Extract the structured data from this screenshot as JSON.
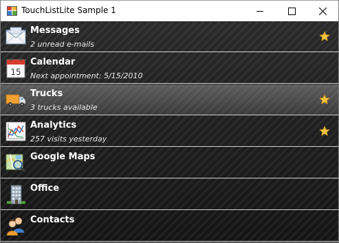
{
  "window": {
    "title": "TouchListLite Sample 1",
    "minimize_icon": "minimize-icon",
    "maximize_icon": "maximize-icon",
    "close_icon": "close-icon"
  },
  "accent_colors": {
    "star": "#f4c23c",
    "separator": "#d4d4d4",
    "selected_row": "#4a4a4a"
  },
  "items": [
    {
      "label": "Messages",
      "subtitle": "2 unread e-mails",
      "icon": "envelope-icon",
      "starred": true
    },
    {
      "label": "Calendar",
      "subtitle": "Next appointment: 5/15/2010",
      "icon": "calendar-icon",
      "calendar_day": "15",
      "starred": false
    },
    {
      "label": "Trucks",
      "subtitle": "3 trucks available",
      "icon": "truck-icon",
      "starred": true,
      "selected": true
    },
    {
      "label": "Analytics",
      "subtitle": "257 visits yesterday",
      "icon": "analytics-chart-icon",
      "starred": true
    },
    {
      "label": "Google Maps",
      "subtitle": "",
      "icon": "map-magnifier-icon",
      "starred": false
    },
    {
      "label": "Office",
      "subtitle": "",
      "icon": "office-building-icon",
      "starred": false
    },
    {
      "label": "Contacts",
      "subtitle": "",
      "icon": "contacts-people-icon",
      "starred": false
    }
  ]
}
